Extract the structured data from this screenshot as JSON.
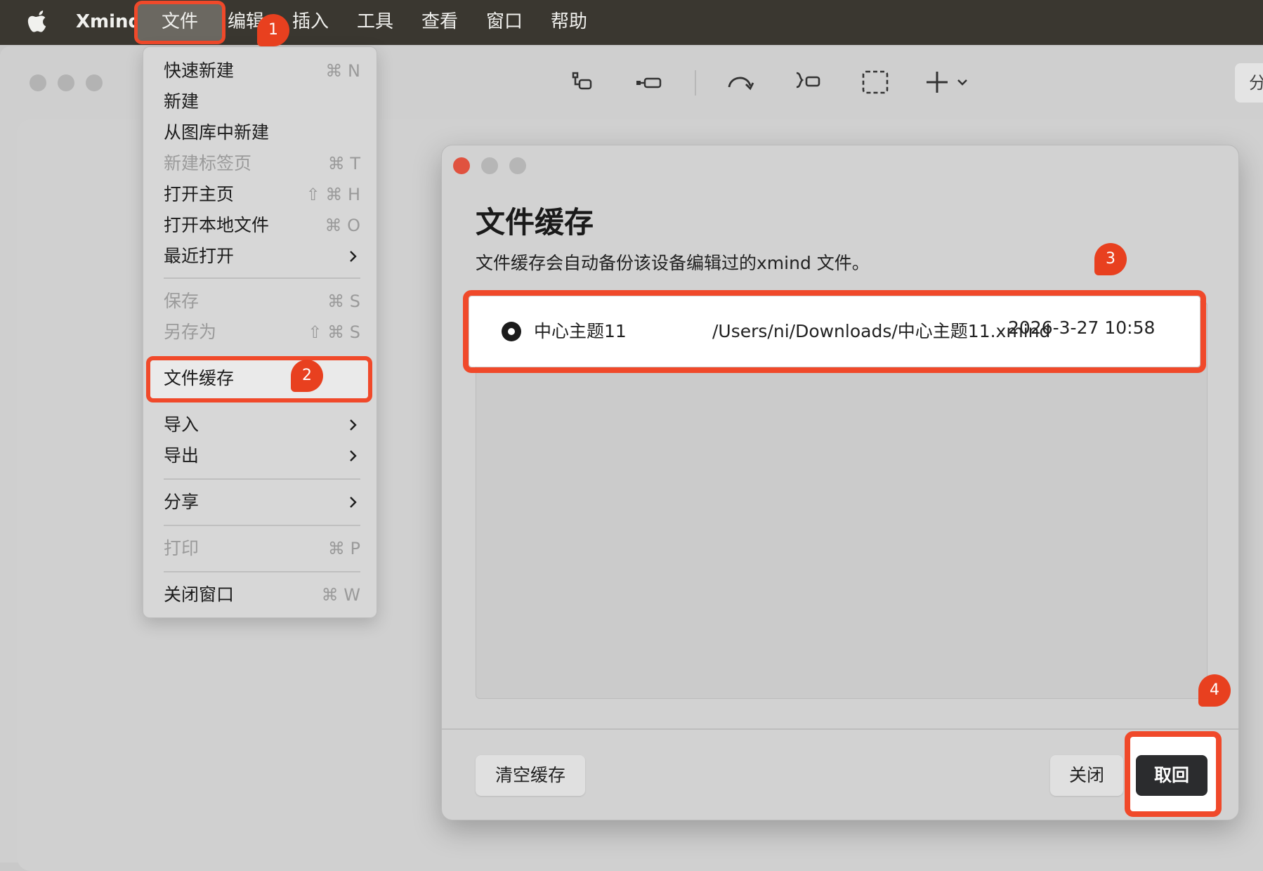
{
  "menubar": {
    "app_name": "Xmind",
    "items": [
      "文件",
      "编辑",
      "插入",
      "工具",
      "查看",
      "窗口",
      "帮助"
    ],
    "active_item": "文件"
  },
  "toolbar": {
    "icons": [
      "subtopic-icon",
      "sibling-topic-icon",
      "relationship-icon",
      "summary-icon",
      "boundary-icon",
      "insert-plus-icon"
    ],
    "share_label": "分"
  },
  "file_menu": {
    "quick_new": {
      "label": "快速新建",
      "shortcut": "⌘ N"
    },
    "new": {
      "label": "新建"
    },
    "new_from_gallery": {
      "label": "从图库中新建"
    },
    "new_tab": {
      "label": "新建标签页",
      "shortcut": "⌘ T"
    },
    "open_home": {
      "label": "打开主页",
      "shortcut": "⇧ ⌘ H"
    },
    "open_local": {
      "label": "打开本地文件",
      "shortcut": "⌘ O"
    },
    "recent": {
      "label": "最近打开"
    },
    "save": {
      "label": "保存",
      "shortcut": "⌘ S"
    },
    "save_as": {
      "label": "另存为",
      "shortcut": "⇧ ⌘ S"
    },
    "file_cache": {
      "label": "文件缓存"
    },
    "import": {
      "label": "导入"
    },
    "export": {
      "label": "导出"
    },
    "share": {
      "label": "分享"
    },
    "print": {
      "label": "打印",
      "shortcut": "⌘ P"
    },
    "close_window": {
      "label": "关闭窗口",
      "shortcut": "⌘ W"
    }
  },
  "dialog": {
    "title": "文件缓存",
    "description": "文件缓存会自动备份该设备编辑过的xmind 文件。",
    "entries": [
      {
        "name": "中心主题11",
        "path": "/Users/ni/Downloads/中心主题11.xmind",
        "date": "2026-3-27 10:58",
        "selected": true
      }
    ],
    "clear_label": "清空缓存",
    "close_label": "关闭",
    "restore_label": "取回"
  },
  "annotations": {
    "badge_1": "1",
    "badge_2": "2",
    "badge_3": "3",
    "badge_4": "4",
    "color": "#f0492a"
  }
}
